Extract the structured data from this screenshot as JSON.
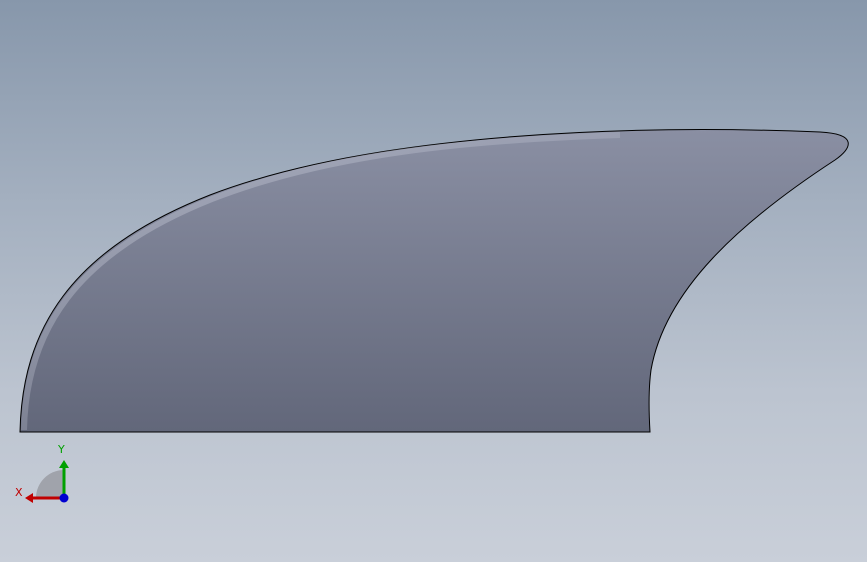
{
  "view": {
    "background_top": "#8797ab",
    "background_bottom": "#c9cfd9",
    "part_color_top": "#8a8fa3",
    "part_color_bottom": "#62677a",
    "edge_color": "#000000"
  },
  "triad": {
    "x_label": "X",
    "y_label": "Y",
    "x_color": "#c00000",
    "y_color": "#00a000",
    "z_color": "#0000d0",
    "x_icon": "x-axis-arrow",
    "y_icon": "y-axis-arrow",
    "z_icon": "z-axis-dot"
  }
}
